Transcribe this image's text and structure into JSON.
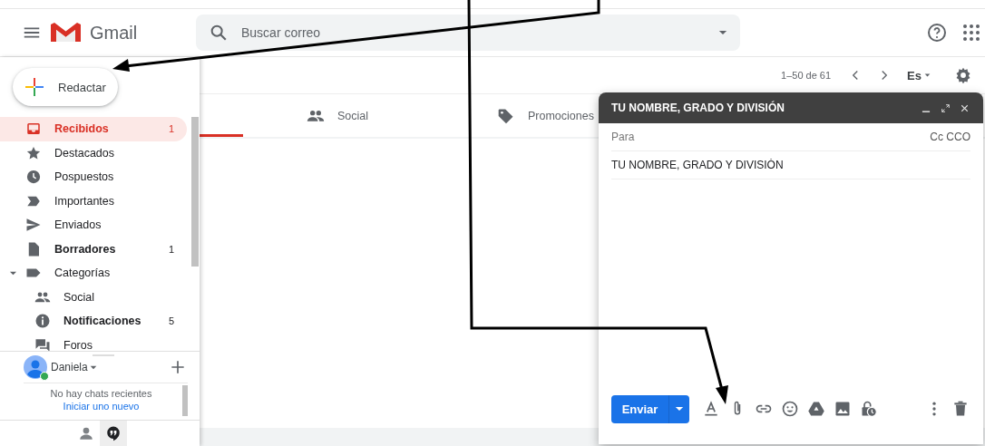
{
  "header": {
    "logo_text": "Gmail",
    "search": {
      "placeholder": "Buscar correo"
    }
  },
  "sidebar": {
    "compose_label": "Redactar",
    "items": [
      {
        "label": "Recibidos",
        "count": "1",
        "bold": true,
        "selected": true
      },
      {
        "label": "Destacados",
        "bold": false,
        "selected": false
      },
      {
        "label": "Pospuestos",
        "bold": false,
        "selected": false
      },
      {
        "label": "Importantes",
        "bold": false,
        "selected": false
      },
      {
        "label": "Enviados",
        "bold": false,
        "selected": false
      },
      {
        "label": "Borradores",
        "count": "1",
        "bold": true,
        "selected": false
      },
      {
        "label": "Categorías",
        "bold": false,
        "selected": false,
        "expanded": true,
        "children": [
          {
            "label": "Social",
            "bold": false,
            "selected": false
          },
          {
            "label": "Notificaciones",
            "count": "5",
            "bold": true,
            "selected": false
          },
          {
            "label": "Foros",
            "bold": false,
            "selected": false
          }
        ]
      }
    ]
  },
  "chat": {
    "user": "Daniela",
    "online": true,
    "empty_text": "No hay chats recientes",
    "start_link": "Iniciar uno nuevo",
    "tabs": [
      {
        "selected": false
      },
      {
        "selected": true
      }
    ]
  },
  "toolbar": {
    "pagination": "1–50 de 61",
    "language": "Es"
  },
  "tabs": [
    {
      "selected": true
    },
    {
      "label": "Social",
      "selected": false
    },
    {
      "label": "Promociones",
      "selected": false
    }
  ],
  "compose": {
    "title": "TU NOMBRE, GRADO Y DIVISIÓN",
    "to_placeholder": "Para",
    "cc_bcc": "Cc CCO",
    "subject": "TU NOMBRE, GRADO Y DIVISIÓN",
    "send_label": "Enviar"
  }
}
